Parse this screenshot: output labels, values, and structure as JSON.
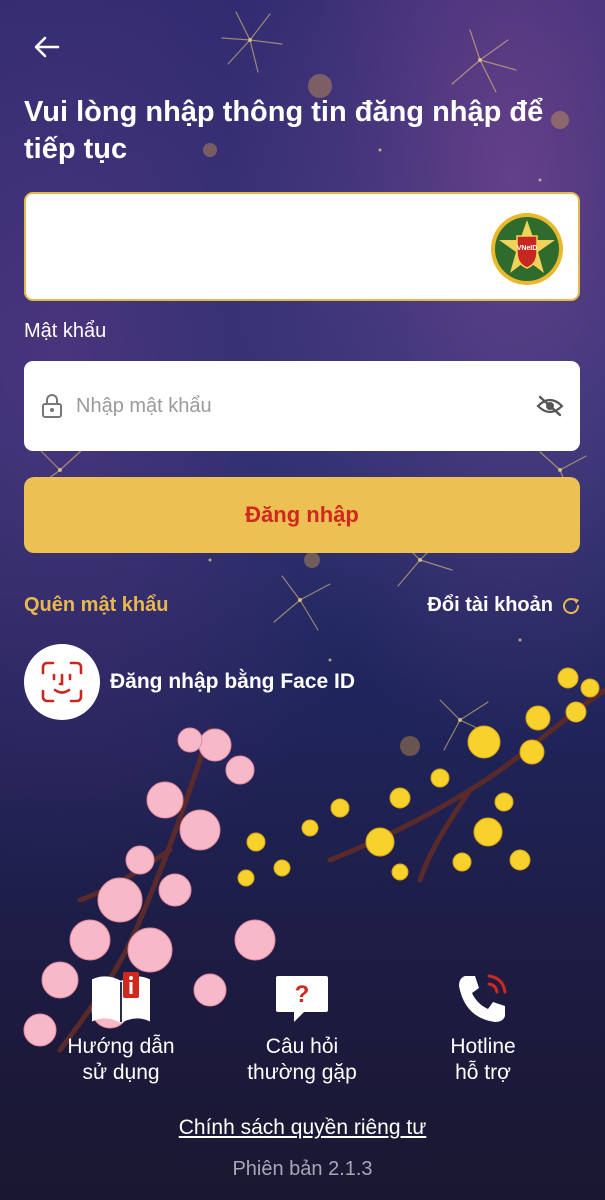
{
  "header": {
    "back_icon": "arrow-left-icon"
  },
  "title": "Vui lòng nhập thông tin đăng nhập để tiếp tục",
  "username": {
    "value": "",
    "logo_text": "VNeID",
    "logo_icon": "vneid-emblem-icon"
  },
  "password": {
    "label": "Mật khẩu",
    "placeholder": "Nhập mật khẩu",
    "value": "",
    "lock_icon": "lock-icon",
    "toggle_icon": "eye-off-icon"
  },
  "login_button": {
    "label": "Đăng nhập"
  },
  "links": {
    "forgot": "Quên mật khẩu",
    "switch_account": "Đổi tài khoản",
    "switch_icon": "refresh-icon"
  },
  "faceid": {
    "label": "Đăng nhập bằng Face ID",
    "icon": "face-id-icon"
  },
  "shortcuts": [
    {
      "label": "Hướng dẫn\nsử dụng",
      "icon": "book-info-icon"
    },
    {
      "label": "Câu hỏi\nthường gặp",
      "icon": "question-bubble-icon"
    },
    {
      "label": "Hotline\nhỗ trợ",
      "icon": "phone-call-icon"
    }
  ],
  "footer": {
    "privacy": "Chính sách quyền riêng tư",
    "version": "Phiên bản 2.1.3"
  },
  "colors": {
    "accent_gold": "#ecc053",
    "login_text_red": "#d0271e",
    "forgot_link": "#e8b84d",
    "background_top": "#2b2a6e",
    "background_bottom": "#1a1730"
  }
}
